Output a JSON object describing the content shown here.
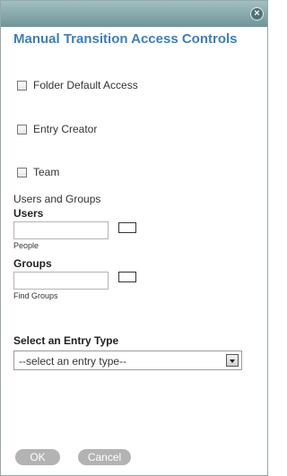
{
  "dialog": {
    "close_glyph": "×",
    "title": "Manual Transition Access Controls"
  },
  "options": {
    "folder_default_access": "Folder Default Access",
    "entry_creator": "Entry Creator",
    "team": "Team"
  },
  "users_groups": {
    "section_label": "Users and Groups",
    "users_label": "Users",
    "users_value": "",
    "users_hint": "People",
    "groups_label": "Groups",
    "groups_value": "",
    "groups_hint": "Find Groups"
  },
  "entry_type": {
    "label": "Select an Entry Type",
    "selected": "--select an entry type--"
  },
  "buttons": {
    "ok": "OK",
    "cancel": "Cancel"
  }
}
